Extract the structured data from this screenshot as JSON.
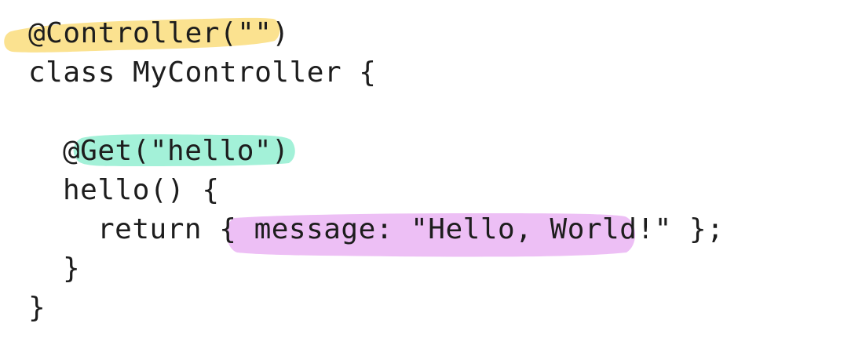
{
  "code": {
    "lines": [
      "@Controller(\"\")",
      "class MyController {",
      "",
      "@Get(\"hello\")",
      "hello() {",
      "return { message: \"Hello, World!\" };",
      "}",
      "}"
    ]
  },
  "highlights": {
    "controller_color": "#fbe08a",
    "get_color": "#9ef0d6",
    "message_color": "#ecbcf4"
  },
  "text_color": "#1d1d1d",
  "background_color": "#ffffff"
}
